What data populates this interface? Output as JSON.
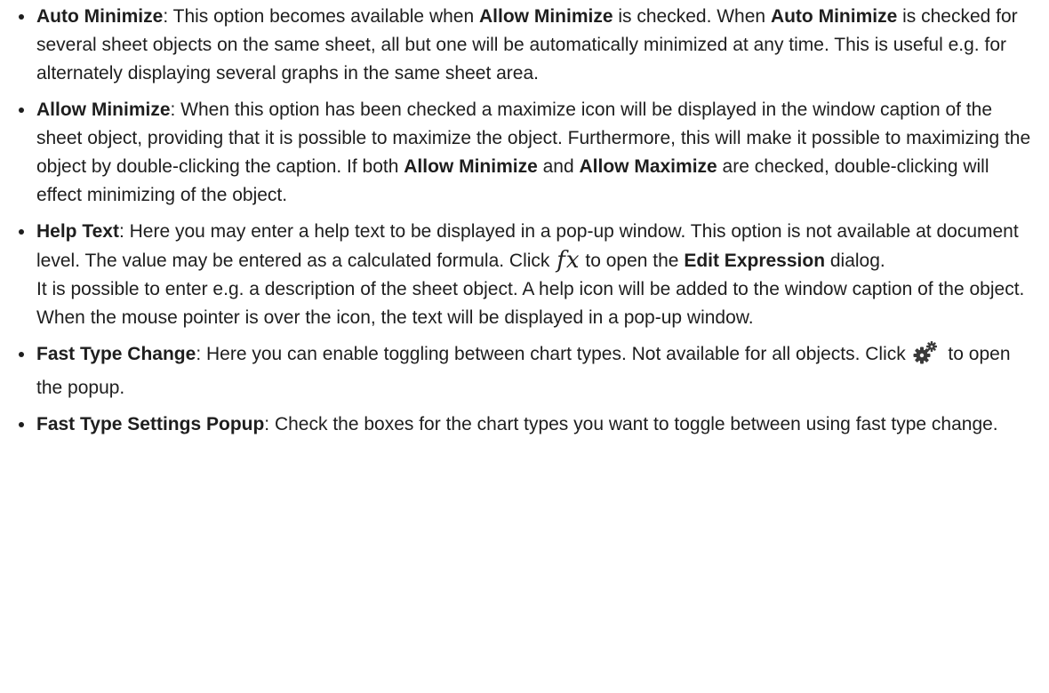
{
  "items": [
    {
      "term": "Auto Minimize",
      "t1": ": This option becomes available when ",
      "b1": "Allow Minimize",
      "t2": " is checked. When ",
      "b2": "Auto Minimize",
      "t3": " is checked for several sheet objects on the same sheet, all but one will be automatically minimized at any time. This is useful e.g. for alternately displaying several graphs in the same sheet area."
    },
    {
      "term": "Allow Minimize",
      "t1": ": When this option has been checked a maximize icon will be displayed in the window caption of the sheet object, providing that it is possible to maximize the object. Furthermore, this will make it possible to maximizing the object by double-clicking the caption. If both ",
      "b1": "Allow Minimize",
      "t2": " and ",
      "b2": "Allow Maximize",
      "t3": " are checked, double-clicking will effect minimizing of the object."
    },
    {
      "term": "Help Text",
      "t1": ": Here you may enter a help text to be displayed in a pop-up window. This option is not available at document level. The value may be entered as a calculated formula. Click ",
      "fx": "fx",
      "t2": " to open the ",
      "b1": "Edit Expression",
      "t3": " dialog.",
      "p2": "It is possible to enter e.g. a description of the sheet object. A help icon will be added to the window caption of the object. When the mouse pointer is over the icon, the text will be displayed in a pop-up window."
    },
    {
      "term": "Fast Type Change",
      "t1": ": Here you can enable toggling between chart types. Not available for all objects. Click ",
      "icon": "gear-icon",
      "t2": " to open the popup."
    },
    {
      "term": "Fast Type Settings Popup",
      "t1": ": Check the boxes for the chart types you want to toggle between using fast type change."
    }
  ]
}
